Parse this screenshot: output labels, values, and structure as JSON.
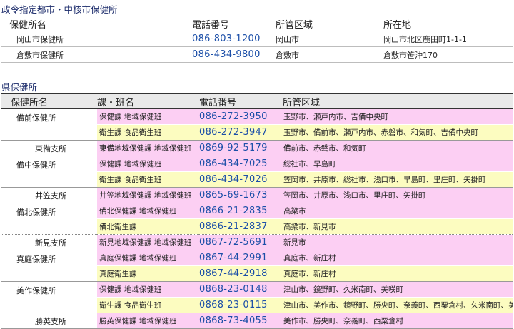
{
  "designated": {
    "title": "政令指定都市・中核市保健所",
    "headers": [
      "保健所名",
      "電話番号",
      "所管区域",
      "所在地"
    ],
    "rows": [
      {
        "name": "岡山市保健所",
        "phone": "086-803-1200",
        "area": "岡山市",
        "address": "岡山市北区鹿田町1-1-1"
      },
      {
        "name": "倉敷市保健所",
        "phone": "086-434-9800",
        "area": "倉敷市",
        "address": "倉敷市笹沖170"
      }
    ]
  },
  "prefectural": {
    "title": "県保健所",
    "headers": [
      "保健所名",
      "課・班名",
      "電話番号",
      "所管区域"
    ],
    "rows": [
      {
        "office": "備前保健所",
        "section": "保健課 地域保健班",
        "phone": "086-272-3950",
        "area": "玉野市、瀬戸内市、吉備中央町",
        "color": "pink"
      },
      {
        "office": "",
        "section": "衛生課 食品衛生班",
        "phone": "086-272-3947",
        "area": "玉野市、備前市、瀬戸内市、赤磐市、和気町、吉備中央町",
        "color": "yellow"
      },
      {
        "office": "東備支所",
        "section": "東備地域保健課 地域保健班",
        "phone": "0869-92-5179",
        "area": "備前市、赤磐市、和気町",
        "color": "pink"
      },
      {
        "office": "備中保健所",
        "section": "保健課 地域保健班",
        "phone": "086-434-7025",
        "area": "総社市、早島町",
        "color": "pink"
      },
      {
        "office": "",
        "section": "衛生課 食品衛生班",
        "phone": "086-434-7026",
        "area": "笠岡市、井原市、総社市、浅口市、早島町、里庄町、矢掛町",
        "color": "yellow"
      },
      {
        "office": "井笠支所",
        "section": "井笠地域保健課 地域保健班",
        "phone": "0865-69-1673",
        "area": "笠岡市、井原市、浅口市、里庄町、矢掛町",
        "color": "pink"
      },
      {
        "office": "備北保健所",
        "section": "備北保健課 地域保健班",
        "phone": "0866-21-2835",
        "area": "高梁市",
        "color": "pink"
      },
      {
        "office": "",
        "section": "備北衛生課",
        "phone": "0866-21-2837",
        "area": "高梁市、新見市",
        "color": "yellow"
      },
      {
        "office": "新見支所",
        "section": "新見地域保健課 地域保健班",
        "phone": "0867-72-5691",
        "area": "新見市",
        "color": "pink"
      },
      {
        "office": "真庭保健所",
        "section": "真庭保健課 地域保健班",
        "phone": "0867-44-2991",
        "area": "真庭市、新庄村",
        "color": "pink"
      },
      {
        "office": "",
        "section": "真庭衛生課",
        "phone": "0867-44-2918",
        "area": "真庭市、新庄村",
        "color": "yellow"
      },
      {
        "office": "美作保健所",
        "section": "保健課 地域保健班",
        "phone": "0868-23-0148",
        "area": "津山市、鏡野町、久米南町、美咲町",
        "color": "pink"
      },
      {
        "office": "",
        "section": "衛生課 食品衛生班",
        "phone": "0868-23-0115",
        "area": "津山市、美作市、鏡野町、勝央町、奈義町、西粟倉村、久米南町、美咲町",
        "color": "yellow"
      },
      {
        "office": "勝英支所",
        "section": "勝英保健課 地域保健班",
        "phone": "0868-73-4055",
        "area": "美作市、勝央町、奈義町、西粟倉村",
        "color": "pink"
      }
    ]
  }
}
